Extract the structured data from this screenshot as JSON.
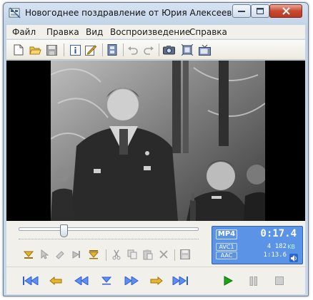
{
  "window": {
    "title": "Новогоднее поздравление от Юрия Алексеевича ..."
  },
  "menu": [
    "Файл",
    "Правка",
    "Вид",
    "Воспроизведение",
    "Справка"
  ],
  "toolbar": {
    "buttons": [
      "new-file-icon",
      "open-folder-icon",
      "save-icon",
      "info-icon",
      "edit-properties-icon",
      "film-icon",
      "undo-icon",
      "redo-icon",
      "snapshot-camera-icon",
      "fit-frame-icon",
      "tv-icon"
    ]
  },
  "seek": {
    "position_fraction": 0.25
  },
  "info": {
    "container": "MP4",
    "time": "0:17.4",
    "video_codec": "AVC1",
    "audio_codec": "AAC",
    "size_value": "4 182",
    "size_unit": "KB",
    "duration": "1:13.6"
  },
  "edit_buttons": [
    "mark-in-icon",
    "select-arrow-icon",
    "eraser-icon",
    "mark-out-icon",
    "mark-end-icon",
    "cut-icon",
    "copy-icon",
    "paste-icon",
    "delete-icon",
    "save-clip-icon"
  ],
  "transport_buttons": [
    "go-to-start-icon",
    "prev-mark-icon",
    "rewind-icon",
    "mark-down-icon",
    "fast-forward-icon",
    "next-mark-icon",
    "go-to-end-icon",
    "play-icon",
    "pause-icon",
    "stop-icon"
  ],
  "colors": {
    "accent_blue": "#5b93e6",
    "play_green": "#1aa51a",
    "transport_blue": "#2f5fd0",
    "mark_gold": "#d9a21b"
  }
}
